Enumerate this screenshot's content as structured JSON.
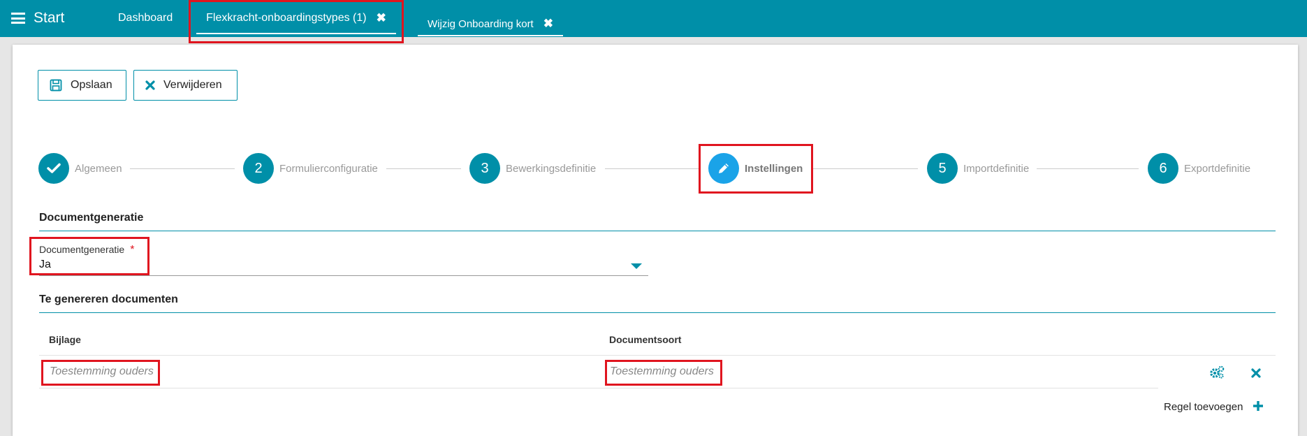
{
  "topbar": {
    "start_label": "Start",
    "tabs": [
      {
        "label": "Dashboard"
      },
      {
        "label": "Flexkracht-onboardingstypes (1)"
      },
      {
        "label": "Wijzig Onboarding kort"
      }
    ],
    "close_glyph": "✖"
  },
  "toolbar": {
    "save_label": "Opslaan",
    "delete_label": "Verwijderen"
  },
  "steps": [
    {
      "label": "Algemeen",
      "marker": "✔",
      "state": "done"
    },
    {
      "label": "Formulierconfiguratie",
      "marker": "2",
      "state": "todo"
    },
    {
      "label": "Bewerkingsdefinitie",
      "marker": "3",
      "state": "todo"
    },
    {
      "label": "Instellingen",
      "marker": "pencil-icon",
      "state": "active"
    },
    {
      "label": "Importdefinitie",
      "marker": "5",
      "state": "todo"
    },
    {
      "label": "Exportdefinitie",
      "marker": "6",
      "state": "todo"
    }
  ],
  "section_documentgeneratie": {
    "title": "Documentgeneratie",
    "field": {
      "label": "Documentgeneratie",
      "required_mark": "*",
      "value": "Ja"
    }
  },
  "section_documents": {
    "title": "Te genereren documenten",
    "columns": [
      "Bijlage",
      "Documentsoort"
    ],
    "rows": [
      {
        "bijlage_placeholder": "Toestemming ouders",
        "documentsoort_placeholder": "Toestemming ouders"
      }
    ],
    "add_row_label": "Regel toevoegen"
  },
  "colors": {
    "brand": "#008fa8",
    "active_step": "#1aa3e8",
    "highlight": "#e0151f"
  }
}
